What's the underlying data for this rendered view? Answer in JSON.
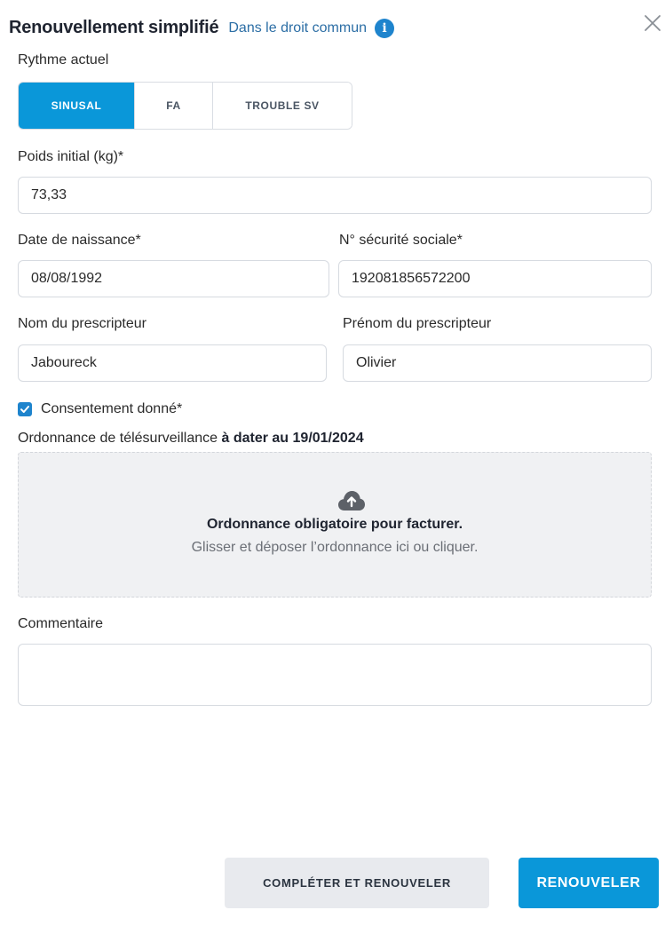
{
  "header": {
    "title": "Renouvellement simplifié",
    "subtitle": "Dans le droit commun",
    "info_icon": "info-icon",
    "close_icon": "close-icon"
  },
  "rythme": {
    "label": "Rythme actuel",
    "options": [
      "SINUSAL",
      "FA",
      "TROUBLE SV"
    ],
    "selected": "SINUSAL"
  },
  "poids": {
    "label": "Poids initial (kg)*",
    "value": "73,33"
  },
  "naissance": {
    "label": "Date de naissance*",
    "value": "08/08/1992"
  },
  "secu": {
    "label": "N° sécurité sociale*",
    "value": "192081856572200"
  },
  "nom_prescripteur": {
    "label": "Nom du prescripteur",
    "value": "Jaboureck"
  },
  "prenom_prescripteur": {
    "label": "Prénom du prescripteur",
    "value": "Olivier"
  },
  "consentement": {
    "label": "Consentement donné*",
    "checked": true
  },
  "ordonnance": {
    "label": "Ordonnance de télésurveillance",
    "label_bold": "à dater au 19/01/2024",
    "dropzone_title": "Ordonnance obligatoire pour facturer.",
    "dropzone_hint": "Glisser et déposer l’ordonnance ici ou cliquer.",
    "icon": "cloud-upload-icon"
  },
  "commentaire": {
    "label": "Commentaire",
    "value": ""
  },
  "actions": {
    "secondary": "COMPLÉTER ET RENOUVELER",
    "primary": "RENOUVELER"
  },
  "colors": {
    "accent": "#0a97d9",
    "link": "#2c6ea5",
    "info": "#1e84cd"
  }
}
